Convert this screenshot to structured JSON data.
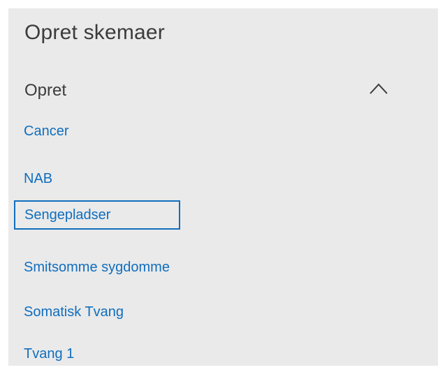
{
  "panel": {
    "title": "Opret skemaer"
  },
  "section": {
    "label": "Opret",
    "expanded": true,
    "toggle_icon": "chevron-up-icon"
  },
  "items": [
    {
      "label": "Cancer",
      "selected": false
    },
    {
      "label": "NAB",
      "selected": false
    },
    {
      "label": "Sengepladser",
      "selected": true
    },
    {
      "label": "Smitsomme sygdomme",
      "selected": false
    },
    {
      "label": "Somatisk Tvang",
      "selected": false
    },
    {
      "label": "Tvang 1",
      "selected": false
    }
  ],
  "colors": {
    "panel_background": "#eaeaea",
    "link": "#106ebe",
    "heading_text": "#3c3c3c",
    "selection_border": "#106ebe"
  }
}
